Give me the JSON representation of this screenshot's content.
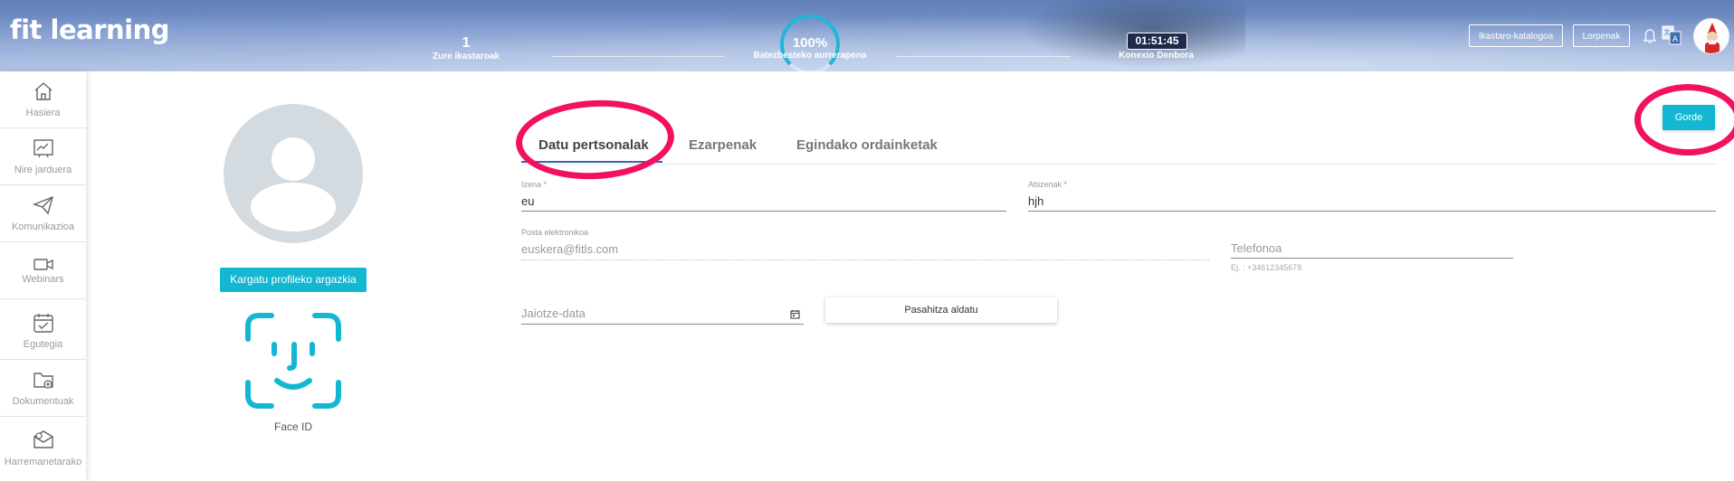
{
  "header": {
    "logo": "fit learning",
    "courses": {
      "value": "1",
      "label": "Zure ikastaroak"
    },
    "progress": {
      "value": "100%",
      "label": "Batezbesteko aurrerapena",
      "fraction": 1.0
    },
    "connection": {
      "value": "01:51:45",
      "label": "Konexio Denbora"
    },
    "catalog_button": "Ikastaro-katalogoa",
    "achievements_button": "Lorpenak",
    "icons": [
      "bell-icon",
      "translate-icon",
      "avatar"
    ]
  },
  "sidebar": {
    "items": [
      {
        "label": "Hasiera",
        "icon": "home-icon"
      },
      {
        "label": "Nire jarduera",
        "icon": "activity-icon"
      },
      {
        "label": "Komunikazioa",
        "icon": "paper-plane-icon"
      },
      {
        "label": "Webinars",
        "icon": "video-camera-icon"
      },
      {
        "label": "Egutegia",
        "icon": "calendar-icon"
      },
      {
        "label": "Dokumentuak",
        "icon": "folder-icon"
      },
      {
        "label": "Harremanetarako",
        "icon": "contact-mail-icon"
      }
    ]
  },
  "profile": {
    "upload_button": "Kargatu profileko argazkia",
    "faceid_label": "Face ID"
  },
  "tabs": [
    {
      "label": "Datu pertsonalak",
      "active": true
    },
    {
      "label": "Ezarpenak",
      "active": false
    },
    {
      "label": "Egindako ordainketak",
      "active": false
    }
  ],
  "form": {
    "name": {
      "label": "Izena *",
      "value": "eu"
    },
    "surname": {
      "label": "Abizenak *",
      "value": "hjh"
    },
    "email": {
      "label": "Posta elektronikoa",
      "value": "euskera@fitls.com"
    },
    "phone": {
      "placeholder": "Telefonoa",
      "hint": "Ej. : +34612345678"
    },
    "birthdate": {
      "placeholder": "Jaiotze-data"
    },
    "change_password": "Pasahitza aldatu",
    "save": "Gorde"
  },
  "colors": {
    "accent": "#14b7d1",
    "highlight": "#f2115f"
  }
}
